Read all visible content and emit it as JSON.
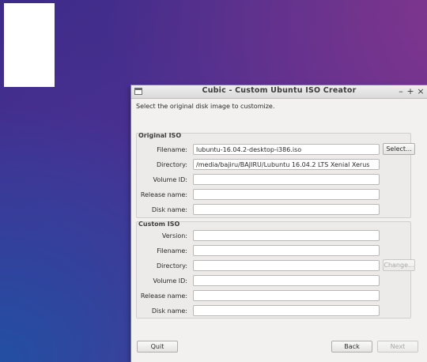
{
  "window": {
    "title": "Cubic - Custom Ubuntu ISO Creator",
    "minimize": "–",
    "maximize": "+",
    "close": "×"
  },
  "intro": "Select the original disk image to customize.",
  "original_iso": {
    "title": "Original ISO",
    "filename_label": "Filename:",
    "filename_value": "lubuntu-16.04.2-desktop-i386.iso",
    "select_button": "Select...",
    "directory_label": "Directory:",
    "directory_value": "/media/bajiru/BAJIRU/Lubuntu 16.04.2 LTS Xenial Xerus",
    "volume_id_label": "Volume ID:",
    "volume_id_value": "",
    "release_name_label": "Release name:",
    "release_name_value": "",
    "disk_name_label": "Disk name:",
    "disk_name_value": ""
  },
  "custom_iso": {
    "title": "Custom ISO",
    "version_label": "Version:",
    "version_value": "",
    "filename_label": "Filename:",
    "filename_value": "",
    "directory_label": "Directory:",
    "directory_value": "",
    "change_button": "Change...",
    "volume_id_label": "Volume ID:",
    "volume_id_value": "",
    "release_name_label": "Release name:",
    "release_name_value": "",
    "disk_name_label": "Disk name:",
    "disk_name_value": ""
  },
  "footer": {
    "quit": "Quit",
    "back": "Back",
    "next": "Next"
  }
}
